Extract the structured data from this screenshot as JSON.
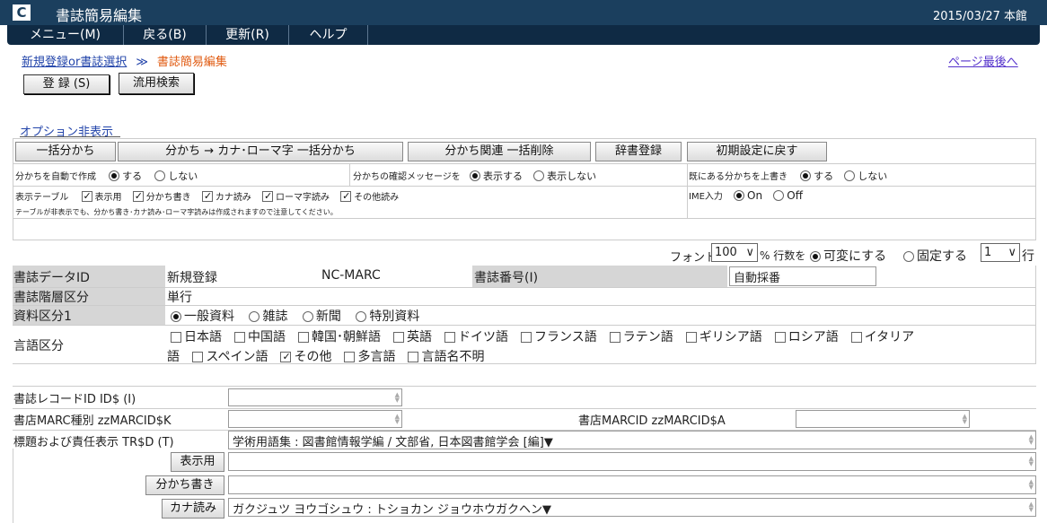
{
  "header": {
    "logo": "C",
    "title": "書誌簡易編集",
    "date_branch": "2015/03/27 本館"
  },
  "menu": [
    "メニュー(M)",
    "戻る(B)",
    "更新(R)",
    "ヘルプ"
  ],
  "breadcrumb": {
    "link": "新規登録or書誌選択",
    "sep": "≫",
    "current": "書誌簡易編集",
    "page_end": "ページ最後へ"
  },
  "buttons": {
    "register": "登 録 (S)",
    "reuse_search": "流用検索"
  },
  "options": {
    "toggle_link": "オプション非表示",
    "buttons": [
      "一括分かち",
      "分かち → カナ･ローマ字 一括分かち",
      "分かち関連 一括削除",
      "辞書登録",
      "初期設定に戻す"
    ],
    "auto_split": {
      "label": "分かちを自動で作成",
      "on": "する",
      "off": "しない",
      "selected": "on"
    },
    "confirm_msg": {
      "label": "分かちの確認メッセージを",
      "on": "表示する",
      "off": "表示しない",
      "selected": "on"
    },
    "overwrite": {
      "label": "既にある分かちを上書き",
      "on": "する",
      "off": "しない",
      "selected": "on"
    },
    "display_table": {
      "label": "表示テーブル",
      "items": [
        "表示用",
        "分かち書き",
        "カナ読み",
        "ローマ字読み",
        "その他読み"
      ]
    },
    "ime": {
      "label": "IME入力",
      "on": "On",
      "off": "Off",
      "selected": "on"
    },
    "note": "テーブルが非表示でも、分かち書き･カナ読み･ローマ字読みは作成されますので注意してください。"
  },
  "font_row": {
    "font_label": "フォント",
    "font_value": "100",
    "pct_label": "% 行数を",
    "variable": "可変にする",
    "fixed": "固定する",
    "rows_value": "1",
    "rows_suffix": "行"
  },
  "record": {
    "id_label": "書誌データID",
    "id_value": "新規登録",
    "source": "NC-MARC",
    "num_label": "書誌番号(I)",
    "num_value": "自動採番",
    "level_label": "書誌階層区分",
    "level_value": "単行",
    "material_label": "資料区分1",
    "material_options": [
      "一般資料",
      "雑誌",
      "新聞",
      "特別資料"
    ],
    "lang_label": "言語区分",
    "lang_row1": [
      "日本語",
      "中国語",
      "韓国･朝鮮語",
      "英語",
      "ドイツ語",
      "フランス語",
      "ラテン語",
      "ギリシア語",
      "ロシア語",
      "イタリア"
    ],
    "lang_row1_tail": "語",
    "lang_row2": [
      "スペイン語",
      "その他",
      "多言語",
      "言語名不明"
    ]
  },
  "fields": {
    "rec_id_label": "書誌レコードID ID$ (I)",
    "marc_type_label": "書店MARC種別 zzMARCID$K",
    "marc_id_label": "書店MARCID zzMARCID$A",
    "title_label": "標題および責任表示 TR$D (T)",
    "title_value": "学術用語集 : 図書館情報学編 / 文部省, 日本図書館学会 [編]▼",
    "display_btn": "表示用",
    "split_btn": "分かち書き",
    "kana_btn": "カナ読み",
    "kana_value": "ガクジュツ ヨウゴシュウ : トショカン ジョウホウガクヘン▼"
  }
}
